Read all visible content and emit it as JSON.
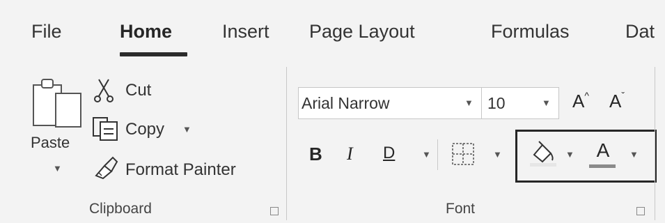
{
  "tabs": [
    "File",
    "Home",
    "Insert",
    "Page Layout",
    "Formulas",
    "Dat"
  ],
  "clipboard": {
    "paste_label": "Paste",
    "cut_label": "Cut",
    "copy_label": "Copy",
    "format_painter_label": "Format Painter",
    "group_label": "Clipboard"
  },
  "font": {
    "font_name": "Arial Narrow",
    "font_size": "10",
    "grow_label": "A",
    "shrink_label": "A",
    "bold_label": "B",
    "italic_label": "I",
    "underline_label": "D",
    "font_color_label": "A",
    "group_label": "Font"
  },
  "colors": {
    "background": "#f3f3f3",
    "fill_color": "#e6e6e6",
    "font_color_bar": "#8a8a8a",
    "highlight_border": "#262626"
  }
}
